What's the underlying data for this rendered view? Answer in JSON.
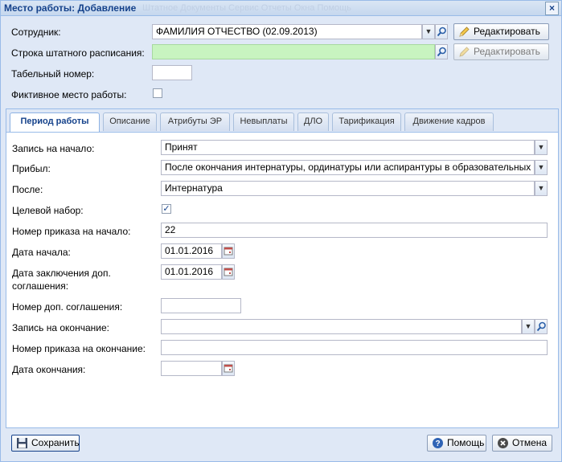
{
  "window": {
    "title": "Место работы: Добавление",
    "ghost_menu": "Штатное   Документы   Сервис   Отчеты   Окна   Помощь",
    "close_glyph": "×"
  },
  "top": {
    "employee_label": "Сотрудник:",
    "employee_value": "ФАМИЛИЯ  ОТЧЕСТВО (02.09.2013)",
    "staff_row_label": "Строка штатного расписания:",
    "staff_row_value": "",
    "tab_number_label": "Табельный номер:",
    "tab_number_value": "",
    "fictive_label": "Фиктивное место работы:",
    "fictive_checked": false,
    "edit_button": "Редактировать",
    "edit_button_2": "Редактировать"
  },
  "tabs": [
    {
      "label": "Период работы",
      "active": true
    },
    {
      "label": "Описание",
      "active": false
    },
    {
      "label": "Атрибуты ЭР",
      "active": false
    },
    {
      "label": "Невыплаты",
      "active": false
    },
    {
      "label": "ДЛО",
      "active": false
    },
    {
      "label": "Тарификация",
      "active": false
    },
    {
      "label": "Движение кадров",
      "active": false
    }
  ],
  "period": {
    "start_record_label": "Запись на начало:",
    "start_record_value": "Принят",
    "arrived_label": "Прибыл:",
    "arrived_value": "После окончания интернатуры, ординатуры или аспирантуры в образовательных",
    "after_label": "После:",
    "after_value": "Интернатура",
    "target_label": "Целевой набор:",
    "target_checked": true,
    "start_order_label": "Номер приказа на начало:",
    "start_order_value": "22",
    "start_date_label": "Дата начала:",
    "start_date_value": "01.01.2016",
    "add_agreement_date_label_1": "Дата заключения доп.",
    "add_agreement_date_label_2": "соглашения:",
    "add_agreement_date_value": "01.01.2016",
    "add_agreement_number_label": "Номер доп. соглашения:",
    "add_agreement_number_value": "",
    "end_record_label": "Запись на окончание:",
    "end_record_value": "",
    "end_order_label": "Номер приказа на окончание:",
    "end_order_value": "",
    "end_date_label": "Дата окончания:",
    "end_date_value": ""
  },
  "buttons": {
    "save": "Сохранить",
    "help": "Помощь",
    "cancel": "Отмена"
  },
  "icons": {
    "dropdown": "chevron-down-icon",
    "search": "search-icon",
    "edit": "pencil-icon",
    "calendar": "calendar-icon",
    "save": "floppy-disk-icon",
    "help": "help-icon",
    "cancel": "cancel-icon"
  }
}
